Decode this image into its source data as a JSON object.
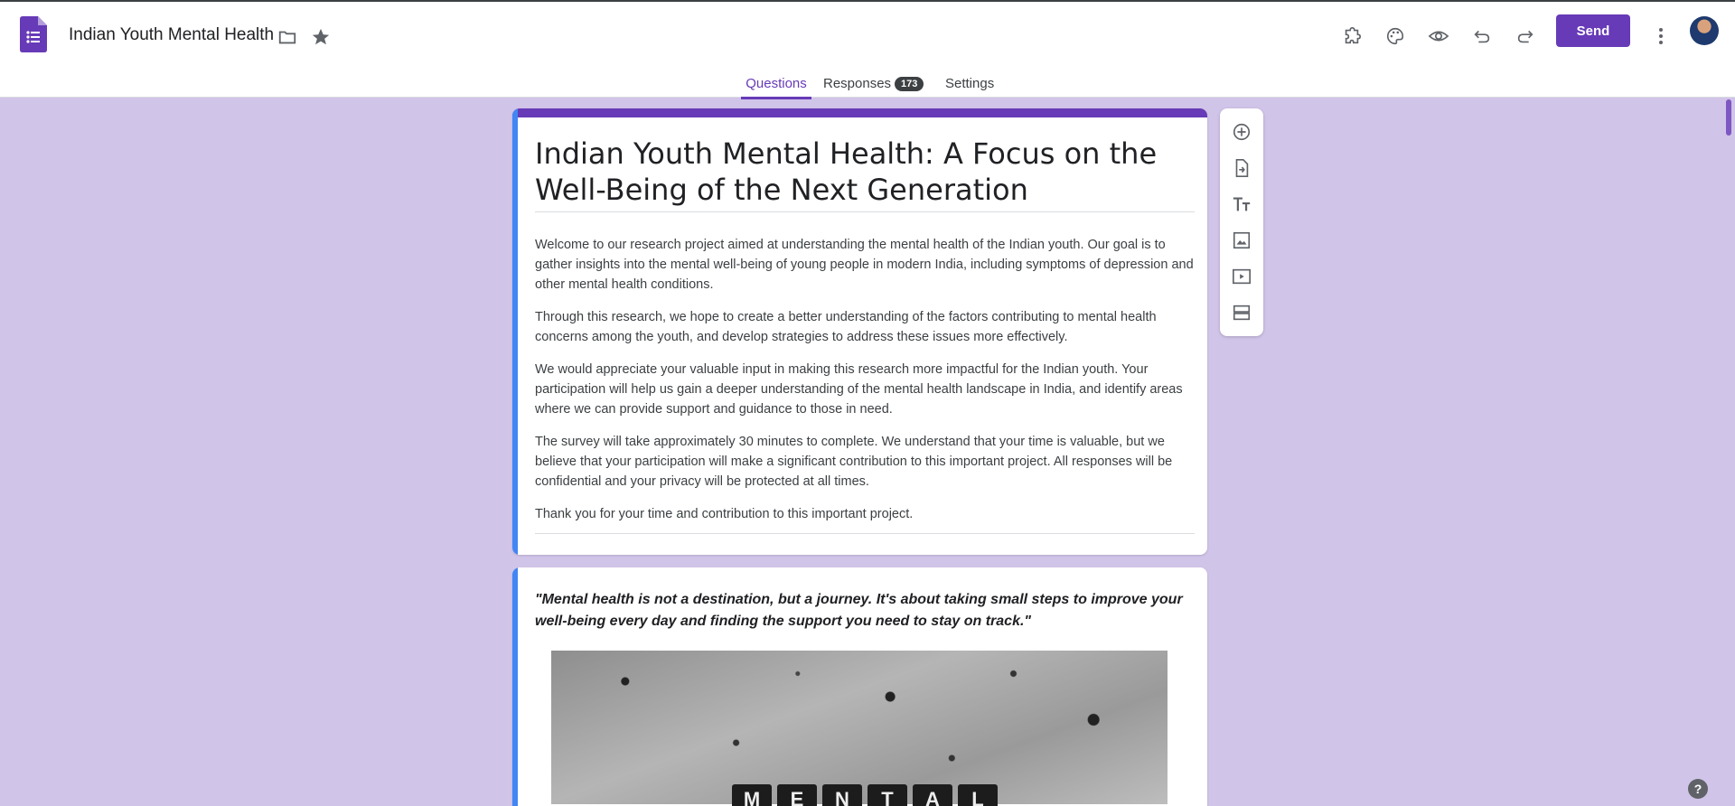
{
  "header": {
    "doc_title": "Indian Youth Mental Health",
    "send_label": "Send",
    "icons": [
      "addons-icon",
      "palette-icon",
      "preview-icon",
      "undo-icon",
      "redo-icon",
      "more-vert-icon"
    ]
  },
  "tabs": [
    {
      "label": "Questions"
    },
    {
      "label": "Responses",
      "badge": "173"
    },
    {
      "label": "Settings"
    }
  ],
  "form": {
    "title": "Indian Youth Mental Health: A Focus on the Well-Being of the Next Generation",
    "paragraphs": [
      "Welcome to our research project aimed at understanding the mental health of the Indian youth. Our goal is to gather insights into the mental well-being of young people in modern India, including symptoms of depression and other mental health conditions.",
      "Through this research, we hope to create a better understanding of the factors contributing to mental health concerns among the youth, and develop strategies to address these issues more effectively.",
      "We would appreciate your valuable input in making this research more impactful for the Indian youth. Your participation will help us gain a deeper understanding of the mental health landscape in India, and identify areas where we can provide support and guidance to those in need.",
      "The survey will take approximately 30 minutes to complete. We understand that your time is valuable, but we believe that your participation will make a significant contribution to this important project. All responses will be confidential and your privacy will be protected at all times.",
      "Thank you for your time and contribution to this important project."
    ]
  },
  "quote_card": {
    "quote": "\"Mental health is not a destination, but a journey. It's about taking small steps to improve your well-being every day and finding the support you need to stay on track.\"",
    "tiles": [
      "M",
      "E",
      "N",
      "T",
      "A",
      "L"
    ]
  },
  "toolbar": {
    "icons": [
      "add-question-icon",
      "import-questions-icon",
      "add-title-icon",
      "add-image-icon",
      "add-video-icon",
      "add-section-icon"
    ]
  },
  "help_label": "?",
  "colors": {
    "accent": "#673ab7",
    "background": "#d1c4e9",
    "left_accent": "#4285f4"
  }
}
